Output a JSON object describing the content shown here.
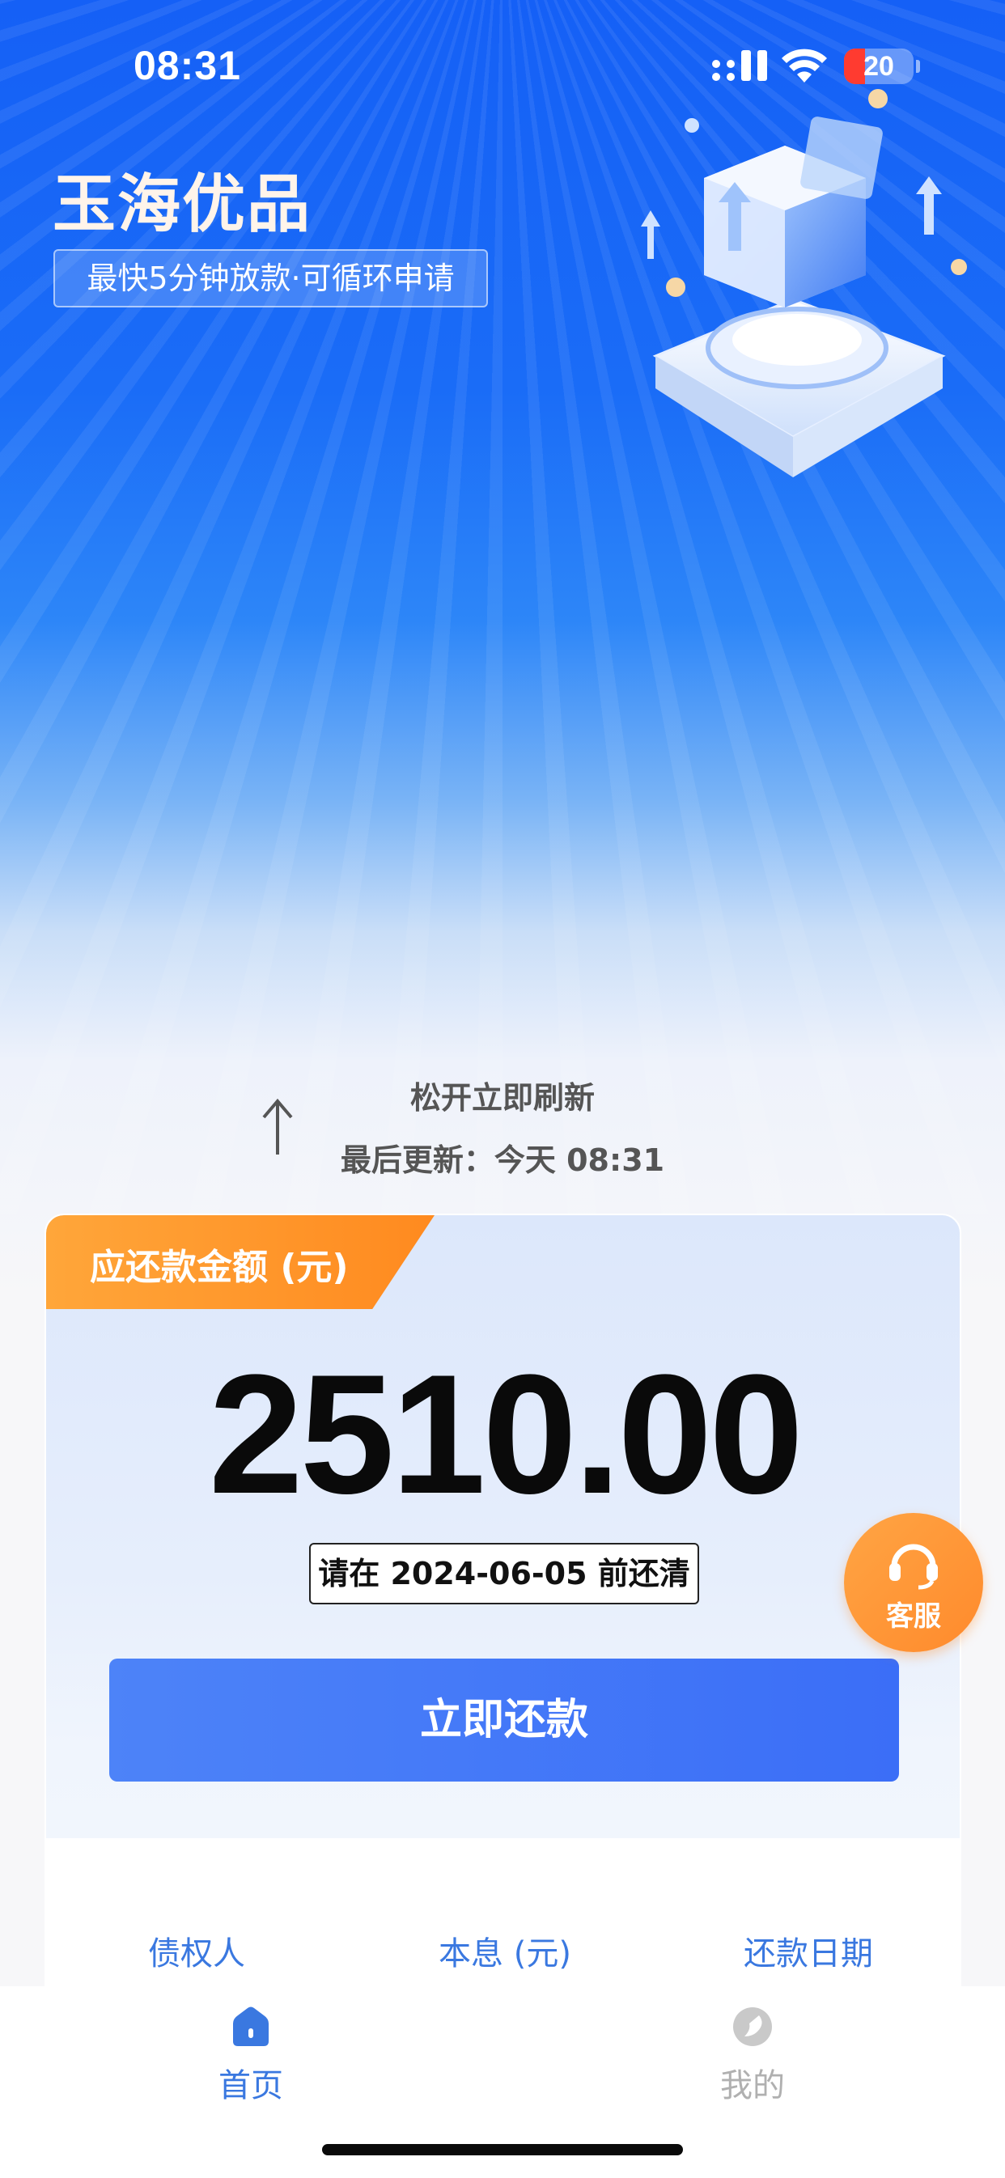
{
  "status_bar": {
    "time": "08:31",
    "battery": "20"
  },
  "brand": {
    "title": "玉海优品",
    "tagline": "最快5分钟放款·可循环申请"
  },
  "refresh": {
    "hint": "松开立即刷新",
    "last_update": "最后更新：今天 08:31"
  },
  "repayment": {
    "label": "应还款金额 (元)",
    "amount": "2510.00",
    "due_note": "请在 2024-06-05 前还清",
    "pay_button": "立即还款",
    "columns": [
      "债权人",
      "本息 (元)",
      "还款日期"
    ]
  },
  "customer_service": {
    "label": "客服"
  },
  "tabs": [
    {
      "label": "首页",
      "icon": "home-icon",
      "active": true
    },
    {
      "label": "我的",
      "icon": "profile-icon",
      "active": false
    }
  ],
  "colors": {
    "primary": "#3b6ef7",
    "accent": "#ff8a1f",
    "tab_active": "#3a78e0",
    "tab_inactive": "#b0b0b0"
  }
}
